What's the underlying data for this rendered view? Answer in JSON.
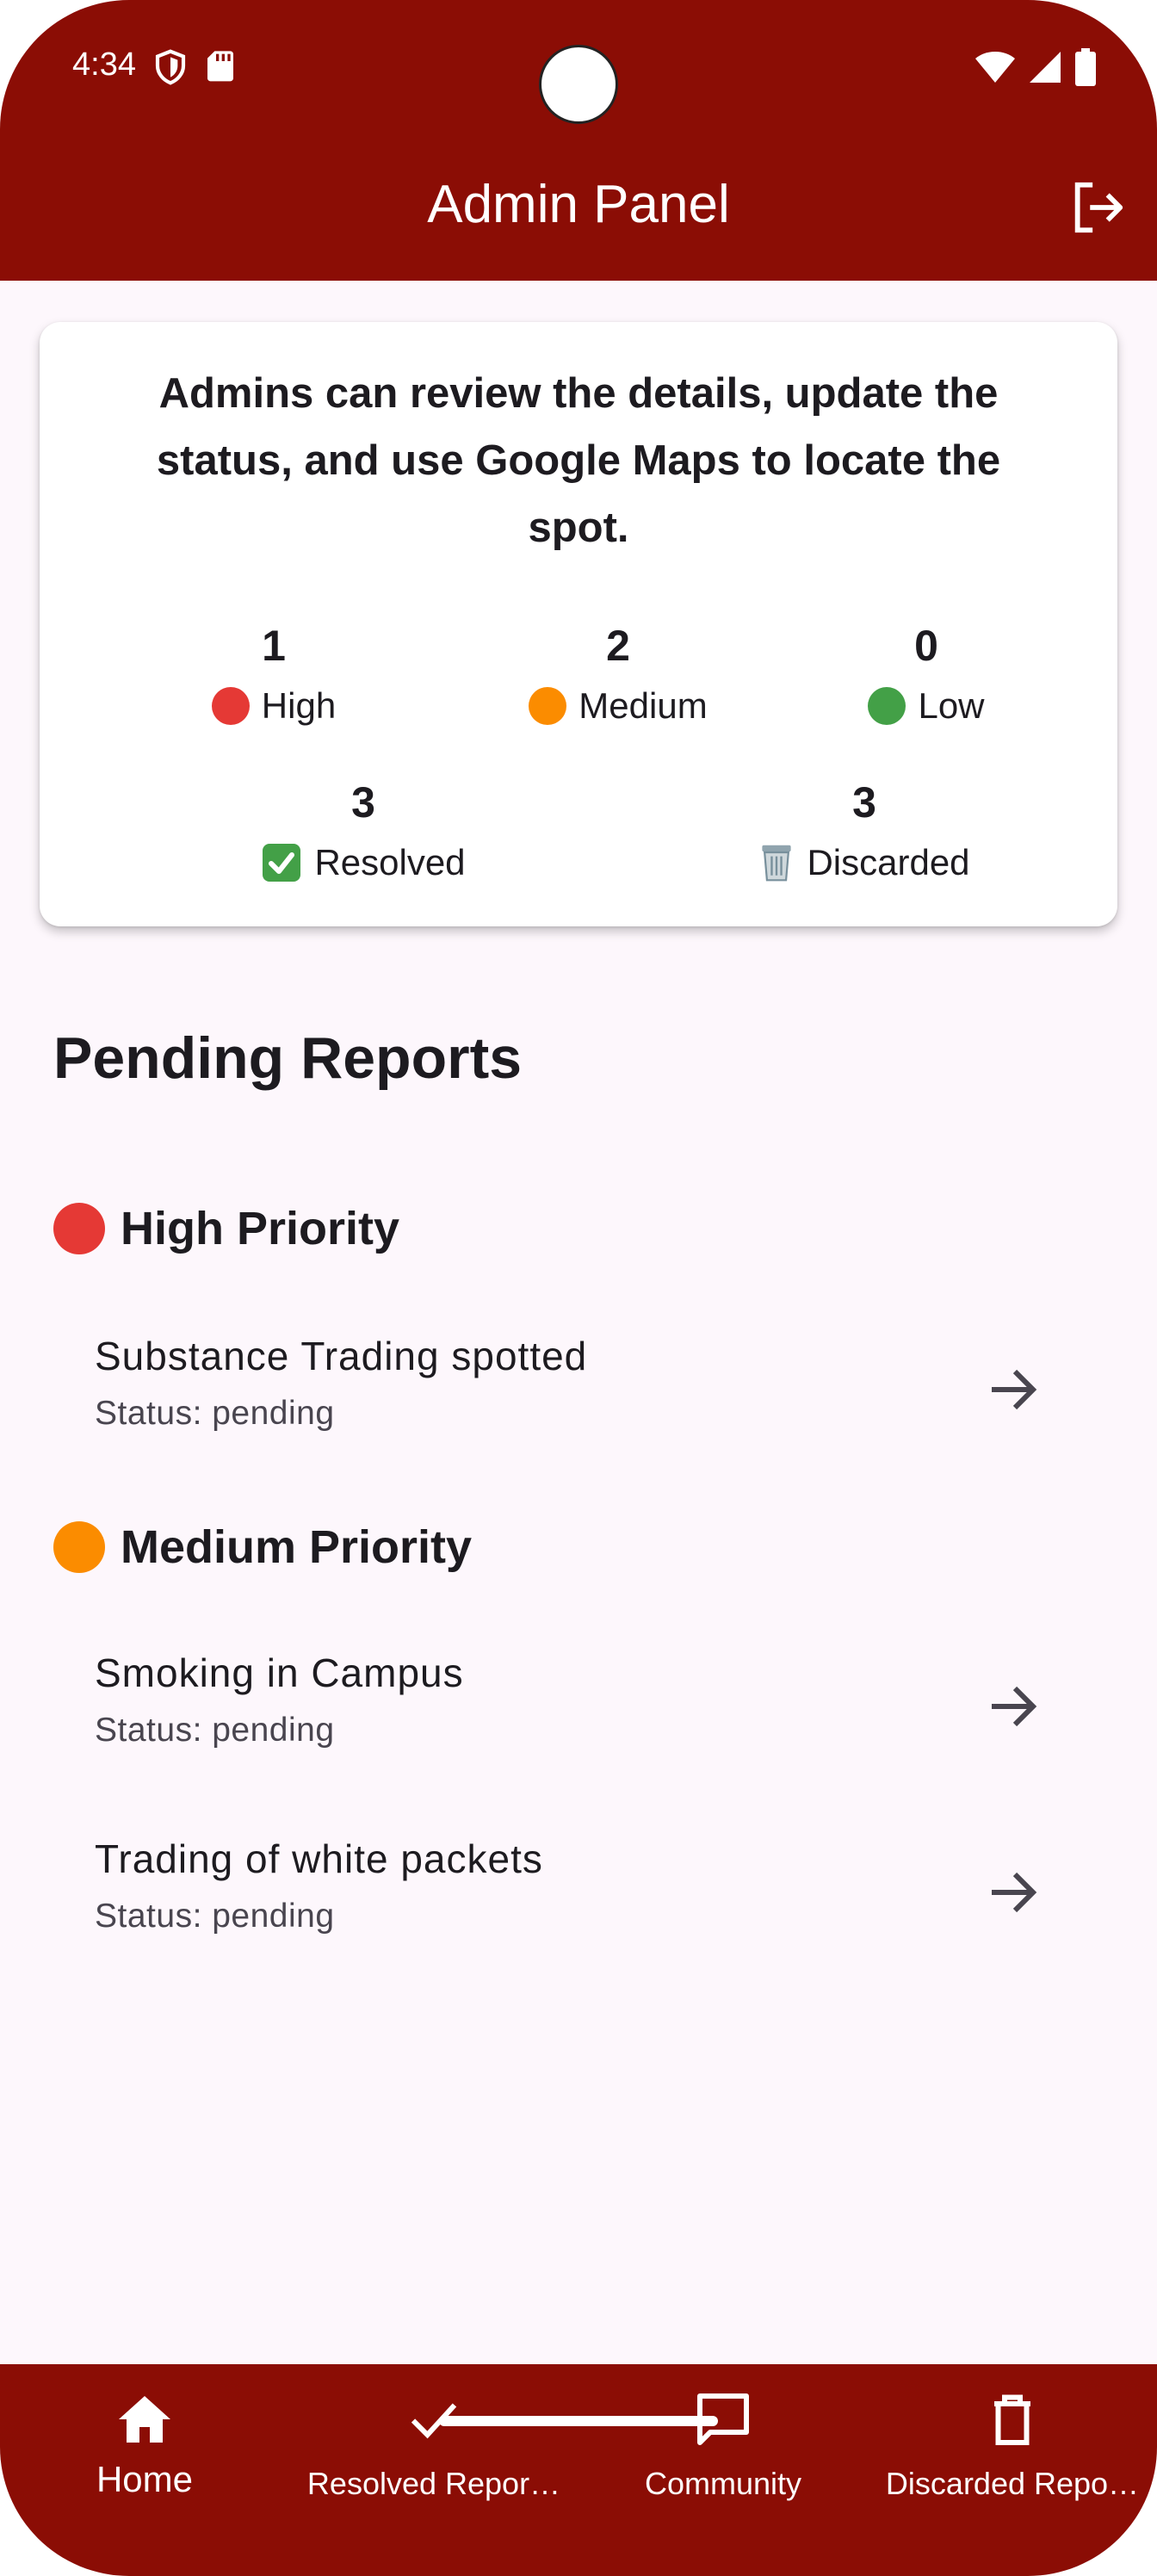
{
  "status_bar": {
    "time": "4:34"
  },
  "appbar": {
    "title": "Admin Panel"
  },
  "summary": {
    "description": "Admins can review the details, update the status, and use Google Maps to locate the spot.",
    "stats": [
      {
        "count": "1",
        "label": "High",
        "color": "#e53935"
      },
      {
        "count": "2",
        "label": "Medium",
        "color": "#fb8c00"
      },
      {
        "count": "0",
        "label": "Low",
        "color": "#43a047"
      },
      {
        "count": "3",
        "label": "Resolved"
      },
      {
        "count": "3",
        "label": "Discarded"
      }
    ]
  },
  "pending": {
    "title": "Pending Reports",
    "groups": [
      {
        "title": "High Priority",
        "color": "#e53935",
        "reports": [
          {
            "title": "Substance Trading spotted",
            "status": "Status: pending"
          }
        ]
      },
      {
        "title": "Medium Priority",
        "color": "#fb8c00",
        "reports": [
          {
            "title": "Smoking in Campus",
            "status": "Status: pending"
          },
          {
            "title": "Trading of white packets",
            "status": "Status: pending"
          }
        ]
      }
    ]
  },
  "bottom_nav": {
    "items": [
      {
        "label": "Home",
        "icon": "home-icon",
        "active": true
      },
      {
        "label": "Resolved Repor…",
        "icon": "check-icon"
      },
      {
        "label": "Community",
        "icon": "chat-icon"
      },
      {
        "label": "Discarded Repo…",
        "icon": "trash-icon"
      }
    ]
  },
  "colors": {
    "primary": "#8b0d05",
    "background": "#fdf7fc",
    "surface": "#ffffff"
  }
}
